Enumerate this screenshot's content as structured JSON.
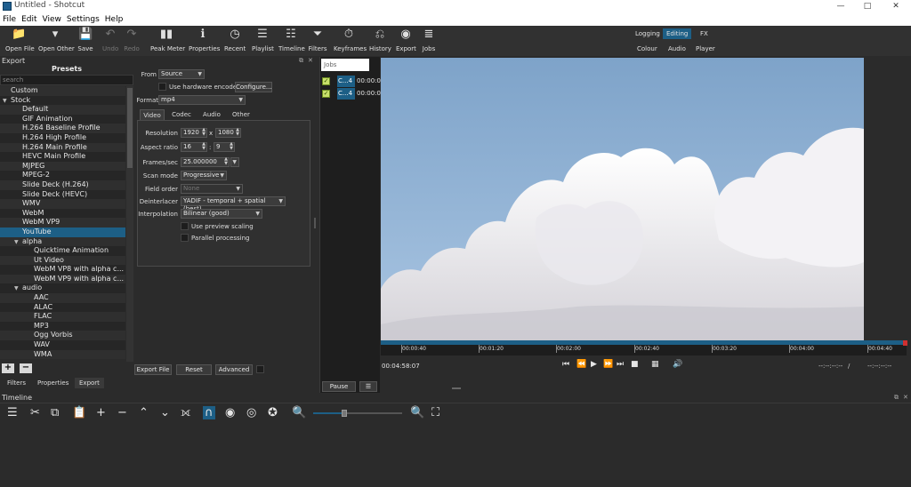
{
  "window": {
    "title": "Untitled - Shotcut",
    "minimize": "—",
    "maximize": "□",
    "close": "✕"
  },
  "menu": [
    "File",
    "Edit",
    "View",
    "Settings",
    "Help"
  ],
  "toolbar": [
    {
      "label": "Open File",
      "icon": "folder-icon",
      "glyph": "📁",
      "enabled": true
    },
    {
      "label": "Open Other",
      "icon": "open-other-icon",
      "glyph": "▾",
      "enabled": true
    },
    {
      "label": "Save",
      "icon": "save-icon",
      "glyph": "💾",
      "enabled": true
    },
    {
      "label": "Undo",
      "icon": "undo-icon",
      "glyph": "↶",
      "enabled": false
    },
    {
      "label": "Redo",
      "icon": "redo-icon",
      "glyph": "↷",
      "enabled": false
    },
    {
      "label": "Peak Meter",
      "icon": "peak-meter-icon",
      "glyph": "▮▮",
      "enabled": true
    },
    {
      "label": "Properties",
      "icon": "info-icon",
      "glyph": "ℹ",
      "enabled": true
    },
    {
      "label": "Recent",
      "icon": "clock-icon",
      "glyph": "◷",
      "enabled": true
    },
    {
      "label": "Playlist",
      "icon": "playlist-icon",
      "glyph": "☰",
      "enabled": true
    },
    {
      "label": "Timeline",
      "icon": "timeline-icon",
      "glyph": "☷",
      "enabled": true
    },
    {
      "label": "Filters",
      "icon": "filter-icon",
      "glyph": "⏷",
      "enabled": true
    },
    {
      "label": "Keyframes",
      "icon": "stopwatch-icon",
      "glyph": "⏱",
      "enabled": true
    },
    {
      "label": "History",
      "icon": "history-icon",
      "glyph": "⎌",
      "enabled": true
    },
    {
      "label": "Export",
      "icon": "export-icon",
      "glyph": "◉",
      "enabled": true
    },
    {
      "label": "Jobs",
      "icon": "jobs-icon",
      "glyph": "≣",
      "enabled": true
    }
  ],
  "layouts": {
    "logging": "Logging",
    "editing": "Editing",
    "fx": "FX",
    "colour": "Colour",
    "audio": "Audio",
    "player": "Player"
  },
  "export": {
    "header": "Export",
    "presets_title": "Presets",
    "search_placeholder": "search",
    "presets": [
      {
        "label": "Custom",
        "level": 0,
        "arrow": "",
        "selected": false
      },
      {
        "label": "Stock",
        "level": 0,
        "arrow": "▼",
        "selected": false
      },
      {
        "label": "Default",
        "level": 1,
        "arrow": "",
        "selected": false
      },
      {
        "label": "GIF Animation",
        "level": 1,
        "arrow": "",
        "selected": false
      },
      {
        "label": "H.264 Baseline Profile",
        "level": 1,
        "arrow": "",
        "selected": false
      },
      {
        "label": "H.264 High Profile",
        "level": 1,
        "arrow": "",
        "selected": false
      },
      {
        "label": "H.264 Main Profile",
        "level": 1,
        "arrow": "",
        "selected": false
      },
      {
        "label": "HEVC Main Profile",
        "level": 1,
        "arrow": "",
        "selected": false
      },
      {
        "label": "MJPEG",
        "level": 1,
        "arrow": "",
        "selected": false
      },
      {
        "label": "MPEG-2",
        "level": 1,
        "arrow": "",
        "selected": false
      },
      {
        "label": "Slide Deck (H.264)",
        "level": 1,
        "arrow": "",
        "selected": false
      },
      {
        "label": "Slide Deck (HEVC)",
        "level": 1,
        "arrow": "",
        "selected": false
      },
      {
        "label": "WMV",
        "level": 1,
        "arrow": "",
        "selected": false
      },
      {
        "label": "WebM",
        "level": 1,
        "arrow": "",
        "selected": false
      },
      {
        "label": "WebM VP9",
        "level": 1,
        "arrow": "",
        "selected": false
      },
      {
        "label": "YouTube",
        "level": 1,
        "arrow": "",
        "selected": true
      },
      {
        "label": "alpha",
        "level": 1,
        "arrow": "▼",
        "selected": false
      },
      {
        "label": "Quicktime Animation",
        "level": 2,
        "arrow": "",
        "selected": false
      },
      {
        "label": "Ut Video",
        "level": 2,
        "arrow": "",
        "selected": false
      },
      {
        "label": "WebM VP8 with alpha c...",
        "level": 2,
        "arrow": "",
        "selected": false
      },
      {
        "label": "WebM VP9 with alpha c...",
        "level": 2,
        "arrow": "",
        "selected": false
      },
      {
        "label": "audio",
        "level": 1,
        "arrow": "▼",
        "selected": false
      },
      {
        "label": "AAC",
        "level": 2,
        "arrow": "",
        "selected": false
      },
      {
        "label": "ALAC",
        "level": 2,
        "arrow": "",
        "selected": false
      },
      {
        "label": "FLAC",
        "level": 2,
        "arrow": "",
        "selected": false
      },
      {
        "label": "MP3",
        "level": 2,
        "arrow": "",
        "selected": false
      },
      {
        "label": "Ogg Vorbis",
        "level": 2,
        "arrow": "",
        "selected": false
      },
      {
        "label": "WAV",
        "level": 2,
        "arrow": "",
        "selected": false
      },
      {
        "label": "WMA",
        "level": 2,
        "arrow": "",
        "selected": false
      }
    ],
    "add_label": "+",
    "remove_label": "−",
    "from_label": "From",
    "from_value": "Source",
    "hw_encoder_label": "Use hardware encoder",
    "configure_label": "Configure...",
    "format_label": "Format",
    "format_value": "mp4",
    "tabs": [
      "Video",
      "Codec",
      "Audio",
      "Other"
    ],
    "resolution_label": "Resolution",
    "resolution_w": "1920",
    "resolution_x": "x",
    "resolution_h": "1080",
    "aspect_label": "Aspect ratio",
    "aspect_w": "16",
    "aspect_colon": ":",
    "aspect_h": "9",
    "fps_label": "Frames/sec",
    "fps_value": "25.000000",
    "scan_label": "Scan mode",
    "scan_value": "Progressive",
    "field_label": "Field order",
    "field_value": "None",
    "deinterlacer_label": "Deinterlacer",
    "deinterlacer_value": "YADIF - temporal + spatial (best)",
    "interp_label": "Interpolation",
    "interp_value": "Bilinear (good)",
    "preview_scaling_label": "Use preview scaling",
    "parallel_label": "Parallel processing",
    "export_file_label": "Export File",
    "reset_label": "Reset",
    "advanced_label": "Advanced",
    "bottom_tabs": [
      "Filters",
      "Properties",
      "Export"
    ]
  },
  "jobs": {
    "title": "Jobs",
    "rows": [
      {
        "name": "C...4",
        "time": "00:00:0"
      },
      {
        "name": "C...4",
        "time": "00:00:0"
      }
    ],
    "pause_label": "Pause",
    "menu_label": "☰"
  },
  "player": {
    "ticks": [
      "00:00:40",
      "00:01:20",
      "00:02:00",
      "00:02:40",
      "00:03:20",
      "00:04:00",
      "00:04:40"
    ],
    "position": "00:04:58:07",
    "in_point": "--:--:--:--",
    "slash": "/",
    "out_point": "--:--:--:--",
    "controls": [
      {
        "name": "skip-previous-icon",
        "glyph": "⏮"
      },
      {
        "name": "rewind-icon",
        "glyph": "⏪"
      },
      {
        "name": "play-icon",
        "glyph": "▶"
      },
      {
        "name": "fast-forward-icon",
        "glyph": "⏩"
      },
      {
        "name": "skip-next-icon",
        "glyph": "⏭"
      },
      {
        "name": "stop-toggle-icon",
        "glyph": "■"
      },
      {
        "name": "grid-icon",
        "glyph": "▦"
      },
      {
        "name": "volume-icon",
        "glyph": "🔊"
      }
    ]
  },
  "timeline": {
    "header": "Timeline",
    "tools": [
      {
        "name": "menu-icon",
        "glyph": "☰"
      },
      {
        "name": "cut-icon",
        "glyph": "✂"
      },
      {
        "name": "copy-icon",
        "glyph": "⧉"
      },
      {
        "name": "paste-icon",
        "glyph": "📋"
      },
      {
        "name": "add-icon",
        "glyph": "+"
      },
      {
        "name": "remove-icon",
        "glyph": "−"
      },
      {
        "name": "lift-icon",
        "glyph": "⌃"
      },
      {
        "name": "overwrite-icon",
        "glyph": "⌄"
      },
      {
        "name": "split-icon",
        "glyph": "⟗"
      },
      {
        "name": "snap-magnet-icon",
        "glyph": "∩"
      },
      {
        "name": "scrub-eye-icon",
        "glyph": "◉"
      },
      {
        "name": "ripple-icon",
        "glyph": "◎"
      },
      {
        "name": "ripple-all-icon",
        "glyph": "✪"
      },
      {
        "name": "zoom-out-icon",
        "glyph": "🔍"
      },
      {
        "name": "zoom-in-icon",
        "glyph": "🔍"
      },
      {
        "name": "zoom-fit-icon",
        "glyph": "⛶"
      }
    ],
    "zoom_level": 0.35
  },
  "colors": {
    "accent": "#1d5f86",
    "sky_top": "#7ea3c9",
    "sky_bottom": "#a7c3e0"
  }
}
